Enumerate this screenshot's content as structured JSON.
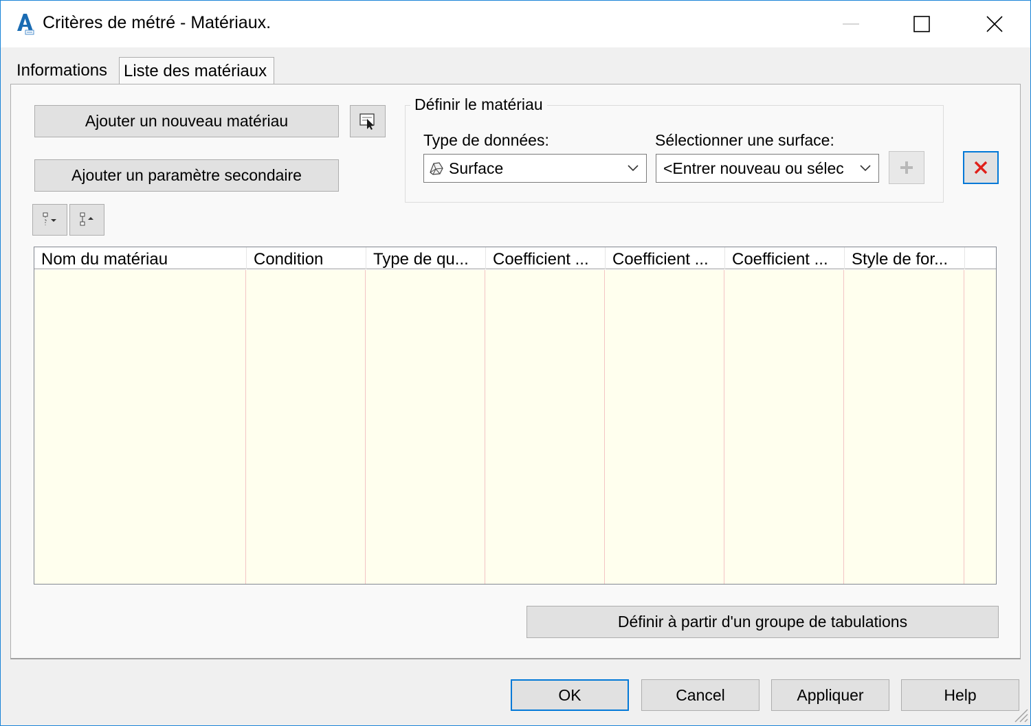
{
  "window": {
    "title": "Critères de métré - Matériaux."
  },
  "tabs": [
    {
      "label": "Informations",
      "active": false
    },
    {
      "label": "Liste des matériaux",
      "active": true
    }
  ],
  "buttons": {
    "add_material": "Ajouter un nouveau matériau",
    "add_secondary": "Ajouter un paramètre secondaire",
    "define_from_tab_group": "Définir à partir d'un groupe de tabulations"
  },
  "define_material": {
    "title": "Définir le matériau",
    "data_type_label": "Type de données:",
    "data_type_value": "Surface",
    "surface_label": "Sélectionner une surface:",
    "surface_value": "<Entrer nouveau ou sélec"
  },
  "grid": {
    "columns": [
      "Nom du matériau",
      "Condition",
      "Type de qu...",
      "Coefficient ...",
      "Coefficient ...",
      "Coefficient ...",
      "Style de for..."
    ],
    "rows": []
  },
  "footer": {
    "ok": "OK",
    "cancel": "Cancel",
    "apply": "Appliquer",
    "help": "Help"
  },
  "colors": {
    "accent": "#0078d7",
    "grid_background": "#ffffee",
    "delete_red": "#e0201a"
  }
}
